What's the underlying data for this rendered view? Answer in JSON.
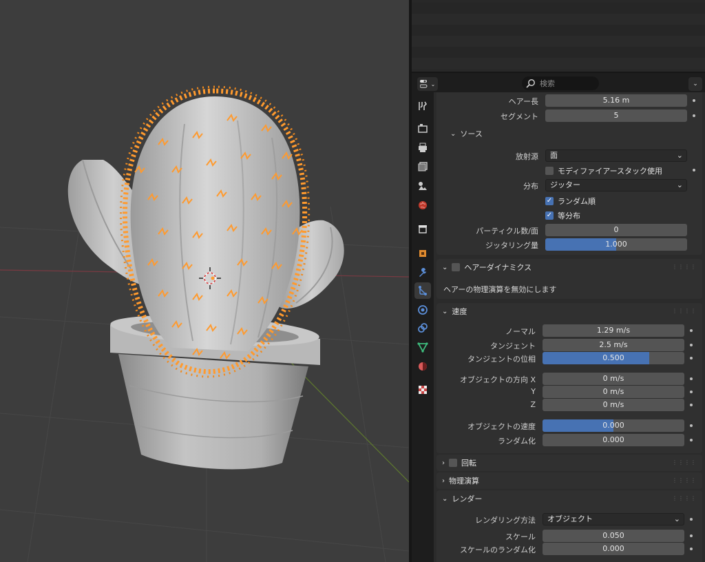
{
  "header": {
    "search_placeholder": "検索"
  },
  "hair": {
    "hair_length_label": "ヘアー長",
    "hair_length": "5.16 m",
    "segments_label": "セグメント",
    "segments": "5"
  },
  "source": {
    "title": "ソース",
    "emit_from_label": "放射源",
    "emit_from": "面",
    "use_modifier_stack": "モディファイアースタック使用",
    "distribution_label": "分布",
    "distribution": "ジッター",
    "random_order": "ランダム順",
    "even_distribution": "等分布",
    "particles_per_face_label": "パーティクル数/面",
    "particles_per_face": "0",
    "jittering_amount_label": "ジッタリング量",
    "jittering_amount": "1.000",
    "jittering_fraction": 0.5
  },
  "hair_dynamics": {
    "title": "ヘアーダイナミクス",
    "message": "ヘアーの物理演算を無効にします"
  },
  "velocity": {
    "title": "速度",
    "normal_label": "ノーマル",
    "normal": "1.29 m/s",
    "tangent_label": "タンジェント",
    "tangent": "2.5 m/s",
    "tangent_phase_label": "タンジェントの位相",
    "tangent_phase": "0.500",
    "tangent_phase_fraction": 0.75,
    "object_aligned_x_label": "オブジェクトの方向 X",
    "object_aligned_x": "0 m/s",
    "y_label": "Y",
    "y": "0 m/s",
    "z_label": "Z",
    "z": "0 m/s",
    "object_velocity_label": "オブジェクトの速度",
    "object_velocity": "0.000",
    "object_velocity_fraction": 0.5,
    "randomize_label": "ランダム化",
    "randomize": "0.000"
  },
  "rotation": {
    "title": "回転"
  },
  "physics": {
    "title": "物理演算"
  },
  "render": {
    "title": "レンダー",
    "render_as_label": "レンダリング方法",
    "render_as": "オブジェクト",
    "scale_label": "スケール",
    "scale": "0.050",
    "scale_random_label": "スケールのランダム化",
    "scale_random": "0.000"
  },
  "colors": {
    "accent": "#4772b3",
    "selection": "#ff9a2e",
    "panel_bg": "#303030"
  },
  "tabs": [
    "tool-icon",
    "render-icon",
    "output-icon",
    "view-layer-icon",
    "scene-icon",
    "world-icon",
    "collection-icon",
    "object-icon",
    "modifier-icon",
    "particles-icon",
    "physics-icon",
    "constraints-icon",
    "data-icon",
    "material-icon",
    "texture-icon"
  ]
}
